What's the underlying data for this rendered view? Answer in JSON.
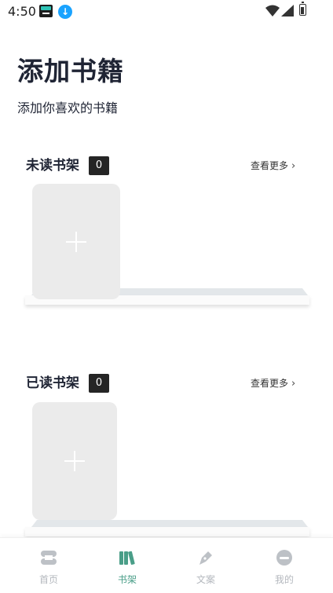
{
  "status_bar": {
    "time": "4:50",
    "download_badge": "↓"
  },
  "header": {
    "title": "添加书籍",
    "subtitle": "添加你喜欢的书籍"
  },
  "shelves": [
    {
      "title": "未读书架",
      "count": "0",
      "more_label": "查看更多",
      "more_icon": "chevron-right-icon"
    },
    {
      "title": "已读书架",
      "count": "0",
      "more_label": "查看更多",
      "more_icon": "chevron-right-icon"
    }
  ],
  "nav": {
    "active": "书架",
    "active_color": "#4a9e88",
    "items": [
      {
        "label": "首页",
        "icon": "home-icon"
      },
      {
        "label": "书架",
        "icon": "books-icon"
      },
      {
        "label": "文案",
        "icon": "pen-icon"
      },
      {
        "label": "我的",
        "icon": "profile-icon"
      }
    ]
  }
}
